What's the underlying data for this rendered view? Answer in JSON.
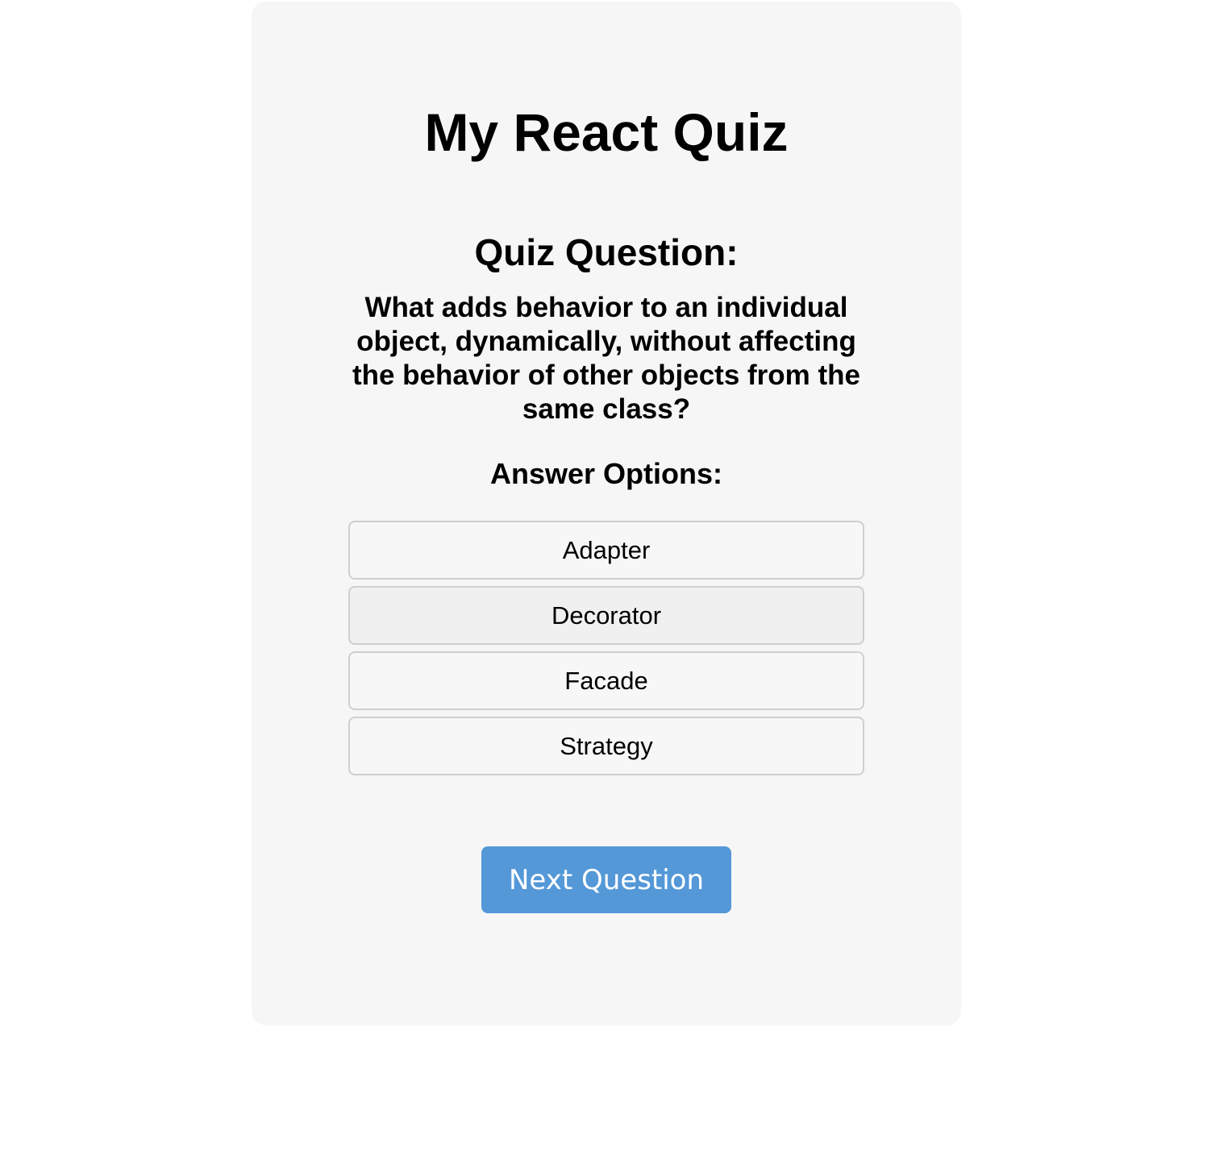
{
  "title": "My React Quiz",
  "question_heading": "Quiz Question:",
  "question_text": "What adds behavior to an individual object, dynamically, without affecting the behavior of other objects from the same class?",
  "answers_heading": "Answer Options:",
  "options": [
    "Adapter",
    "Decorator",
    "Facade",
    "Strategy"
  ],
  "next_label": "Next Question",
  "colors": {
    "accent": "#5498d8",
    "card": "#f6f6f6"
  }
}
